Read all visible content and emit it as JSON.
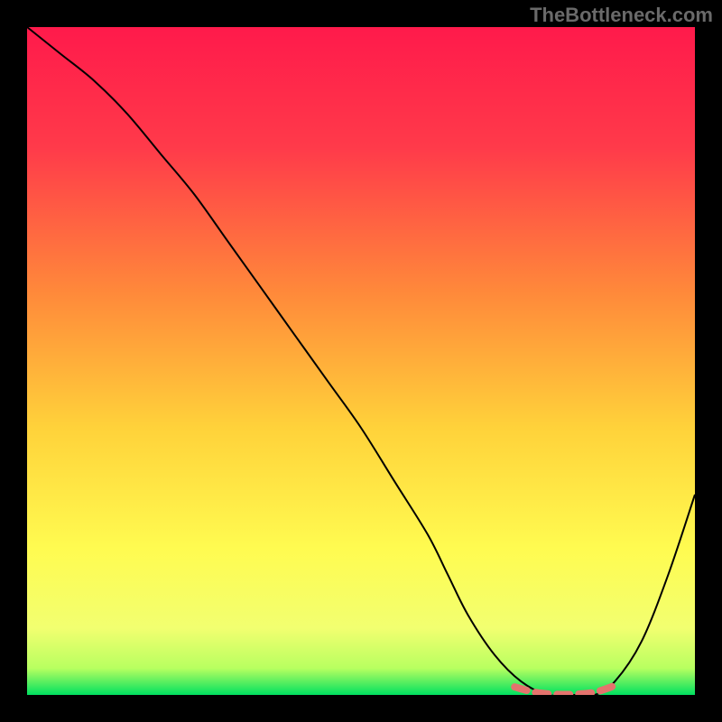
{
  "watermark": "TheBottleneck.com",
  "chart_data": {
    "type": "line",
    "title": "",
    "xlabel": "",
    "ylabel": "",
    "xlim": [
      0,
      100
    ],
    "ylim": [
      0,
      100
    ],
    "series": [
      {
        "name": "bottleneck-curve",
        "x": [
          0,
          5,
          10,
          15,
          20,
          25,
          30,
          35,
          40,
          45,
          50,
          55,
          60,
          63,
          66,
          70,
          74,
          78,
          82,
          85,
          88,
          92,
          96,
          100
        ],
        "y": [
          100,
          96,
          92,
          87,
          81,
          75,
          68,
          61,
          54,
          47,
          40,
          32,
          24,
          18,
          12,
          6,
          2,
          0,
          0,
          0,
          2,
          8,
          18,
          30
        ]
      },
      {
        "name": "optimal-marker",
        "x": [
          73,
          76,
          79,
          82,
          85,
          88
        ],
        "y": [
          1.2,
          0.4,
          0.1,
          0.1,
          0.4,
          1.4
        ]
      }
    ],
    "gradient_stops": [
      {
        "offset": 0.0,
        "color": "#ff1a4b"
      },
      {
        "offset": 0.18,
        "color": "#ff3a4a"
      },
      {
        "offset": 0.4,
        "color": "#ff8a3a"
      },
      {
        "offset": 0.6,
        "color": "#ffd23a"
      },
      {
        "offset": 0.78,
        "color": "#fffb50"
      },
      {
        "offset": 0.9,
        "color": "#f2ff70"
      },
      {
        "offset": 0.96,
        "color": "#b8ff60"
      },
      {
        "offset": 1.0,
        "color": "#00e060"
      }
    ],
    "curve_style": {
      "stroke": "#000000",
      "stroke_width": 2
    },
    "marker_style": {
      "stroke": "#e4736d",
      "stroke_width": 8,
      "dash": "14 10"
    }
  }
}
